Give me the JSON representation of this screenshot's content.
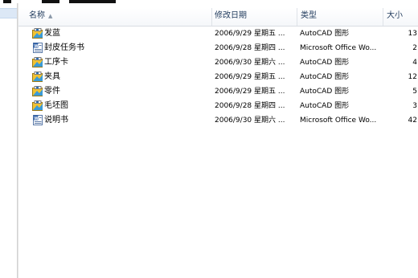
{
  "columns": {
    "name": "名称",
    "modified": "修改日期",
    "type": "类型",
    "size": "大小"
  },
  "files": [
    {
      "name": "发蓝",
      "modified": "2006/9/29 星期五 ...",
      "type": "AutoCAD 图形",
      "size": "13",
      "icon": "autocad-drawing-icon"
    },
    {
      "name": "封皮任务书",
      "modified": "2006/9/28 星期四 ...",
      "type": "Microsoft Office Wo...",
      "size": "2",
      "icon": "word-document-icon"
    },
    {
      "name": "工序卡",
      "modified": "2006/9/30 星期六 ...",
      "type": "AutoCAD 图形",
      "size": "4",
      "icon": "autocad-drawing-icon"
    },
    {
      "name": "夹具",
      "modified": "2006/9/29 星期五 ...",
      "type": "AutoCAD 图形",
      "size": "12",
      "icon": "autocad-drawing-icon"
    },
    {
      "name": "零件",
      "modified": "2006/9/29 星期五 ...",
      "type": "AutoCAD 图形",
      "size": "5",
      "icon": "autocad-drawing-icon"
    },
    {
      "name": "毛坯图",
      "modified": "2006/9/28 星期四 ...",
      "type": "AutoCAD 图形",
      "size": "3",
      "icon": "autocad-drawing-icon"
    },
    {
      "name": "说明书",
      "modified": "2006/9/30 星期六 ...",
      "type": "Microsoft Office Wo...",
      "size": "42",
      "icon": "word-document-icon"
    }
  ]
}
